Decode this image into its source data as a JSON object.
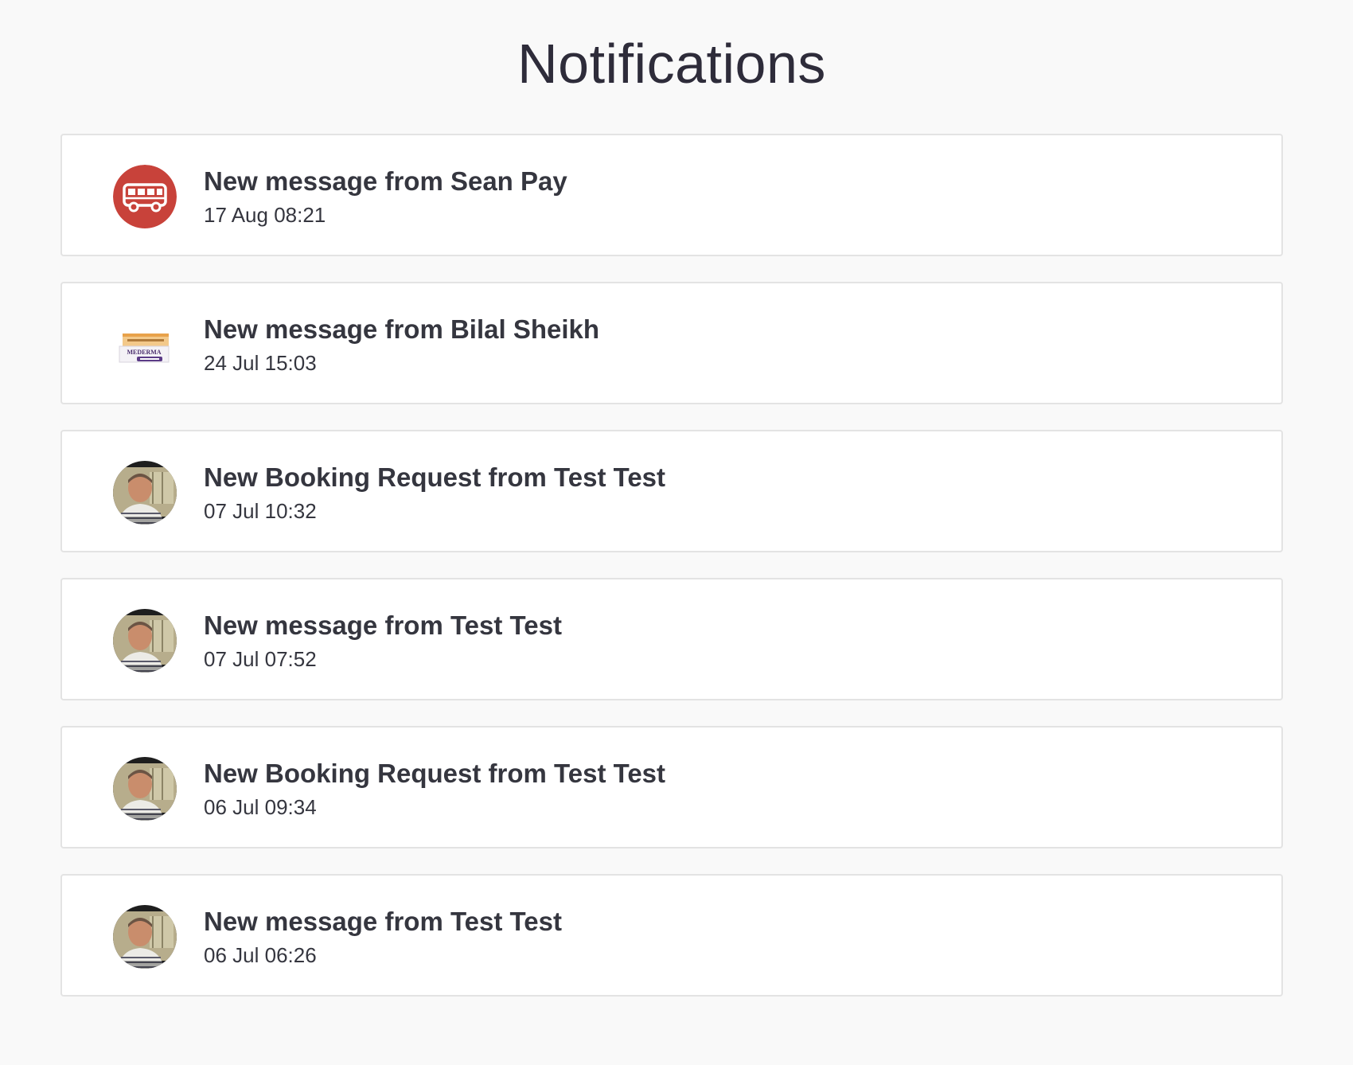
{
  "page": {
    "title": "Notifications"
  },
  "notifications": [
    {
      "title": "New message from Sean Pay",
      "time": "17 Aug 08:21",
      "avatar": "bus-icon"
    },
    {
      "title": "New message from Bilal Sheikh",
      "time": "24 Jul 15:03",
      "avatar": "product-thumbnail",
      "avatar_text": "MEDERMA"
    },
    {
      "title": "New Booking Request from Test Test",
      "time": "07 Jul 10:32",
      "avatar": "user-photo"
    },
    {
      "title": "New message from Test Test",
      "time": "07 Jul 07:52",
      "avatar": "user-photo"
    },
    {
      "title": "New Booking Request from Test Test",
      "time": "06 Jul 09:34",
      "avatar": "user-photo"
    },
    {
      "title": "New message from Test Test",
      "time": "06 Jul 06:26",
      "avatar": "user-photo"
    }
  ],
  "colors": {
    "background": "#f9f9f9",
    "card": "#ffffff",
    "card_border": "#e3e3e3",
    "bus_badge": "#c8423a",
    "text": "#35363f"
  }
}
